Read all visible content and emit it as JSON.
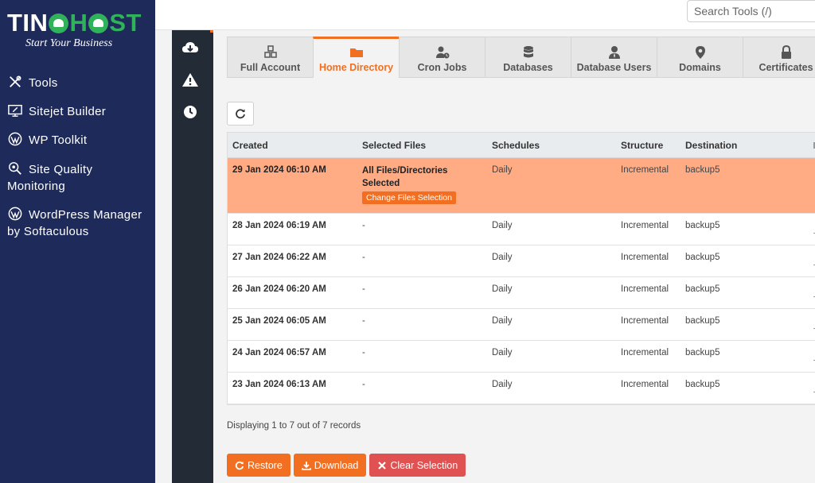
{
  "brand": {
    "name_part1": "TIN",
    "name_part2": "H",
    "name_part3": "ST",
    "tagline": "Start Your Business"
  },
  "sidebar": {
    "items": [
      {
        "label": "Tools",
        "icon": "tools-icon"
      },
      {
        "label": "Sitejet Builder",
        "icon": "sitejet-icon"
      },
      {
        "label": "WP Toolkit",
        "icon": "wordpress-icon"
      },
      {
        "label": "Site Quality Monitoring",
        "icon": "search-gear-icon"
      },
      {
        "label": "WordPress Manager by Softaculous",
        "icon": "wordpress-icon"
      }
    ]
  },
  "search": {
    "placeholder": "Search Tools (/)"
  },
  "rail": {
    "icons": [
      "cloud-download-icon",
      "warning-icon",
      "clock-icon"
    ]
  },
  "tabs": [
    {
      "label": "Full Account",
      "icon": "cubes-icon"
    },
    {
      "label": "Home Directory",
      "icon": "folder-icon",
      "active": true
    },
    {
      "label": "Cron Jobs",
      "icon": "user-clock-icon"
    },
    {
      "label": "Databases",
      "icon": "database-icon"
    },
    {
      "label": "Database Users",
      "icon": "user-tie-icon"
    },
    {
      "label": "Domains",
      "icon": "map-marker-icon"
    },
    {
      "label": "Certificates",
      "icon": "lock-icon"
    }
  ],
  "table": {
    "headers": [
      "Created",
      "Selected Files",
      "Schedules",
      "Structure",
      "Destination"
    ],
    "rows": [
      {
        "created": "29 Jan 2024 06:10 AM",
        "files": "All Files/Directories Selected",
        "schedule": "Daily",
        "structure": "Incremental",
        "destination": "backup5",
        "selected": true
      },
      {
        "created": "28 Jan 2024 06:19 AM",
        "files": "-",
        "schedule": "Daily",
        "structure": "Incremental",
        "destination": "backup5"
      },
      {
        "created": "27 Jan 2024 06:22 AM",
        "files": "-",
        "schedule": "Daily",
        "structure": "Incremental",
        "destination": "backup5"
      },
      {
        "created": "26 Jan 2024 06:20 AM",
        "files": "-",
        "schedule": "Daily",
        "structure": "Incremental",
        "destination": "backup5"
      },
      {
        "created": "25 Jan 2024 06:05 AM",
        "files": "-",
        "schedule": "Daily",
        "structure": "Incremental",
        "destination": "backup5"
      },
      {
        "created": "24 Jan 2024 06:57 AM",
        "files": "-",
        "schedule": "Daily",
        "structure": "Incremental",
        "destination": "backup5"
      },
      {
        "created": "23 Jan 2024 06:13 AM",
        "files": "-",
        "schedule": "Daily",
        "structure": "Incremental",
        "destination": "backup5"
      }
    ],
    "change_selection_label": "Change Files Selection"
  },
  "records_text": "Displaying 1 to 7 out of 7 records",
  "actions": {
    "restore": "Restore",
    "download": "Download",
    "clear": "Clear Selection"
  },
  "colors": {
    "sidebar": "#1e2a5a",
    "accent": "#f26f21",
    "selected_row": "#ffab84",
    "danger": "#e05252",
    "brand_green": "#2fb25a"
  }
}
